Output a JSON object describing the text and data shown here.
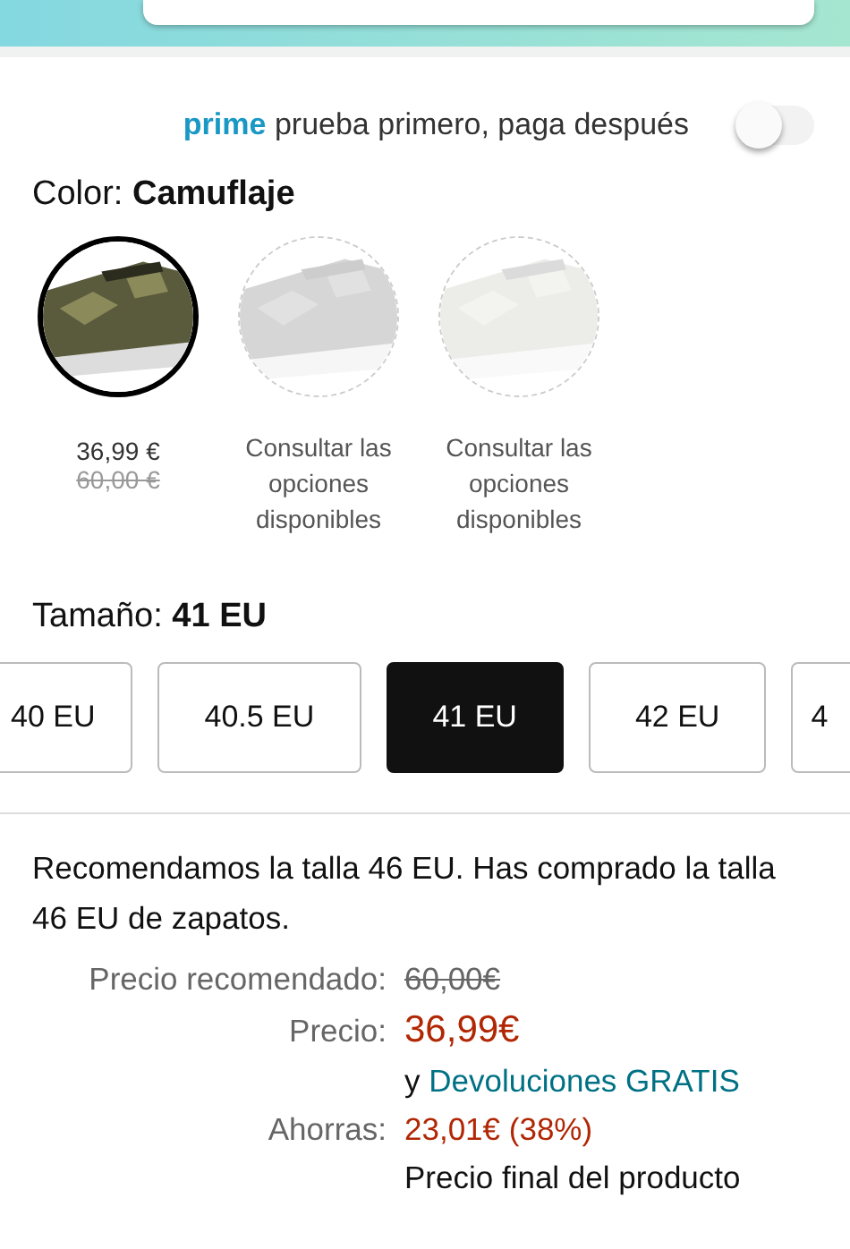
{
  "prime": {
    "badge": "prime",
    "text": "prueba primero, paga después",
    "on": false
  },
  "color": {
    "label": "Color:",
    "value": "Camuflaje"
  },
  "swatches": [
    {
      "selected": true,
      "price": "36,99 €",
      "list_price": "60,00 €"
    },
    {
      "selected": false,
      "note": "Consultar las opciones disponibles"
    },
    {
      "selected": false,
      "note": "Consultar las opciones disponibles"
    }
  ],
  "size": {
    "label": "Tamaño:",
    "value": "41 EU"
  },
  "sizes": [
    {
      "label": "40 EU",
      "selected": false
    },
    {
      "label": "40.5 EU",
      "selected": false
    },
    {
      "label": "41 EU",
      "selected": true
    },
    {
      "label": "42 EU",
      "selected": false
    },
    {
      "label": "4",
      "selected": false
    }
  ],
  "recommendation": "Recomendamos la talla 46 EU. Has comprado la talla 46 EU de zapatos.",
  "prices": [
    {
      "kind": "list",
      "label": "Precio recomendado:",
      "value": "60,00€"
    },
    {
      "kind": "price",
      "label": "Precio:",
      "value": "36,99€"
    },
    {
      "kind": "returns",
      "prefix": "y",
      "link": "Devoluciones GRATIS"
    },
    {
      "kind": "savings",
      "label": "Ahorras:",
      "value": "23,01€ (38%)"
    },
    {
      "kind": "note",
      "value": "Precio final del producto"
    }
  ]
}
